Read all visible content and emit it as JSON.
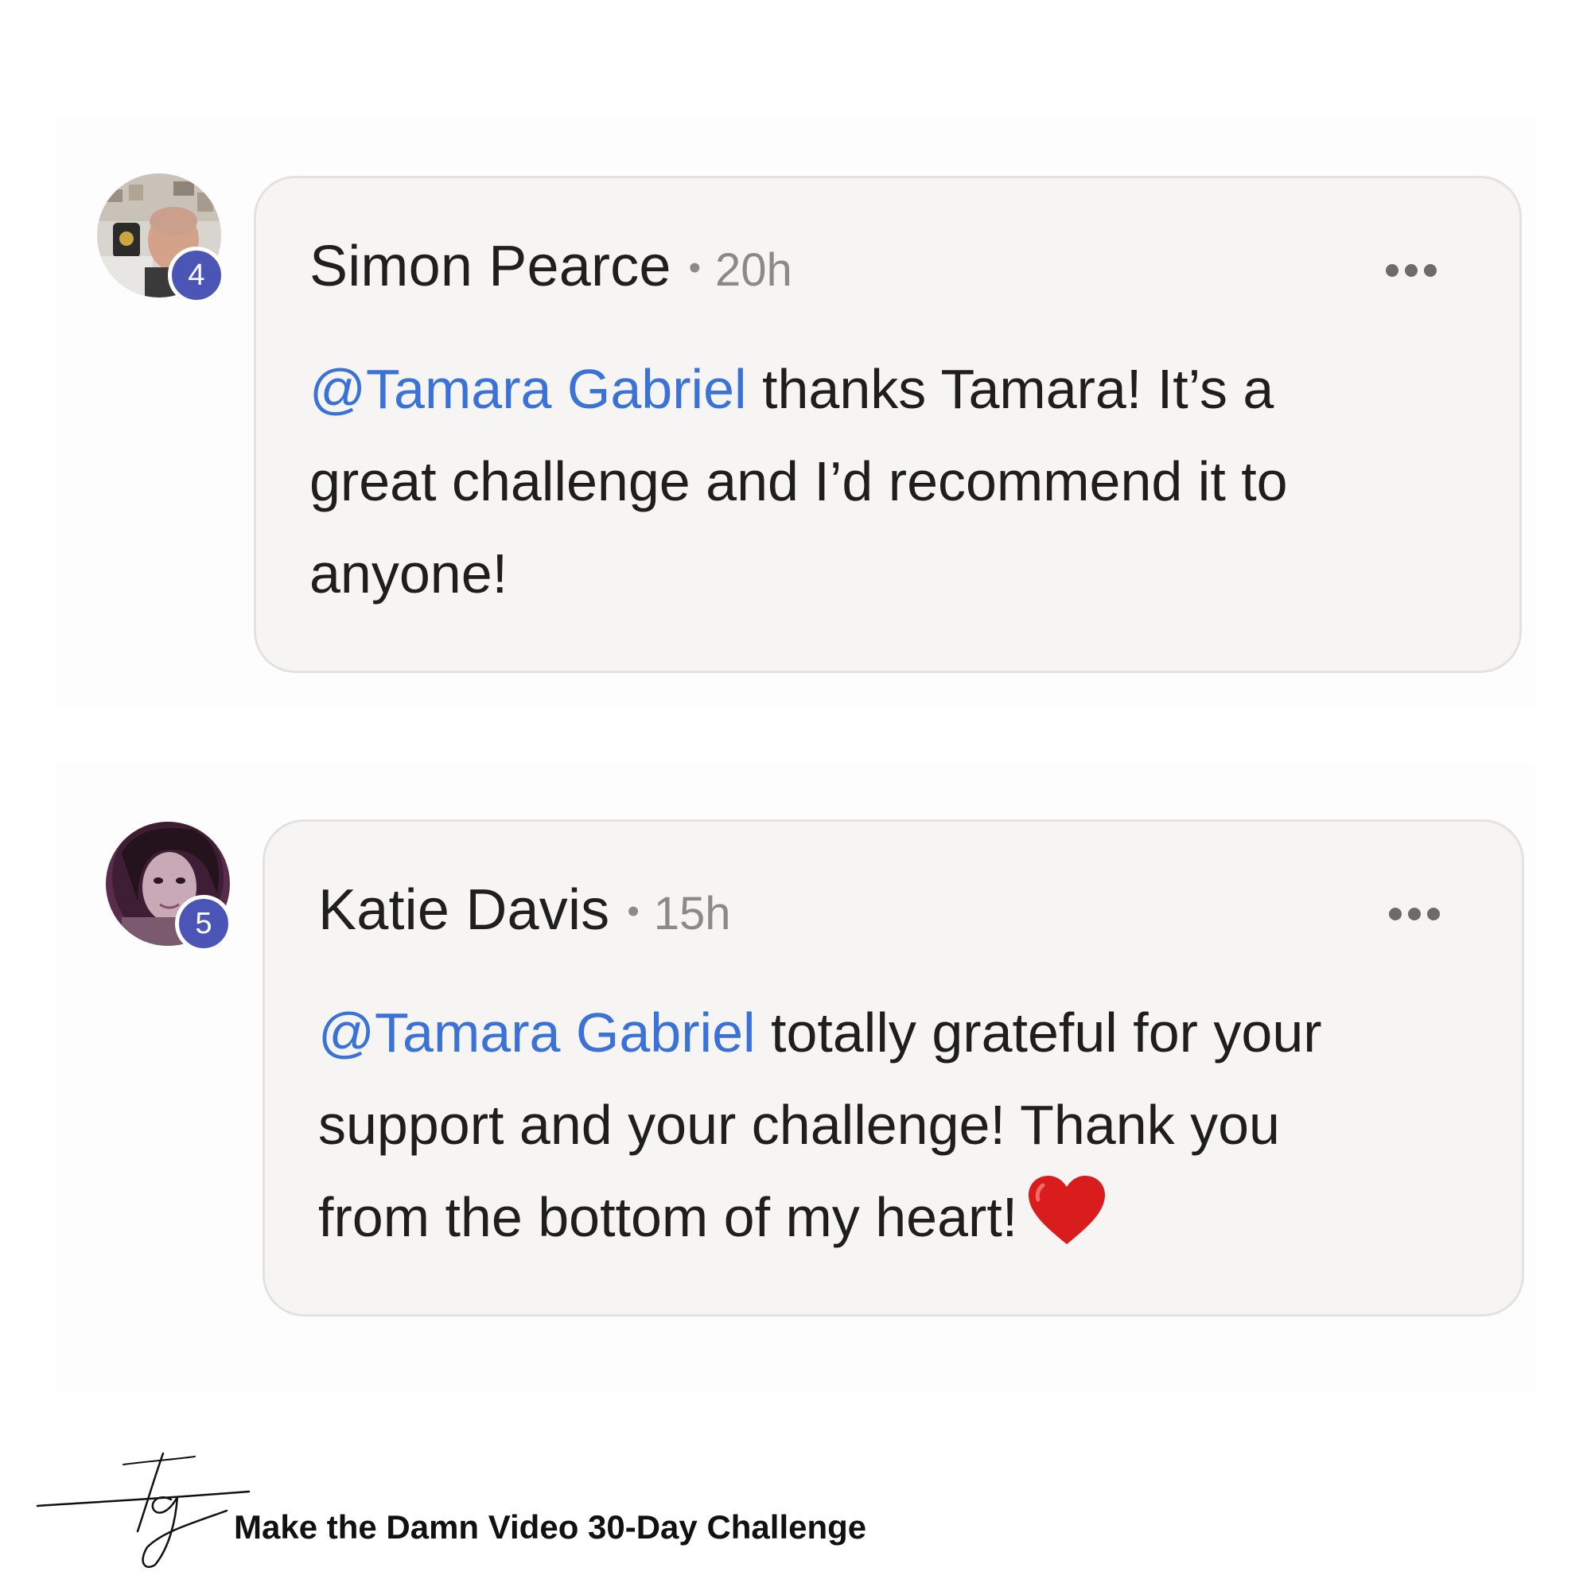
{
  "comments": [
    {
      "author": "Simon Pearce",
      "separator": "•",
      "time": "20h",
      "badge": "4",
      "mention": "@Tamara Gabriel",
      "lines": [
        " thanks Tamara! It’s a",
        "great challenge and I’d recommend it to",
        "anyone!"
      ]
    },
    {
      "author": "Katie Davis",
      "separator": "•",
      "time": "15h",
      "badge": "5",
      "mention": "@Tamara Gabriel",
      "lines": [
        " totally grateful for your",
        "support and your challenge! Thank you",
        "from the bottom of my heart!"
      ],
      "emoji": "heart"
    }
  ],
  "footer": {
    "logo_text": "tg",
    "title": "Make the Damn Video 30-Day Challenge"
  },
  "colors": {
    "mention": "#3a72d8",
    "badge": "#4b55b5",
    "bubble": "#f6f5f4",
    "heart": "#d91c1c"
  }
}
